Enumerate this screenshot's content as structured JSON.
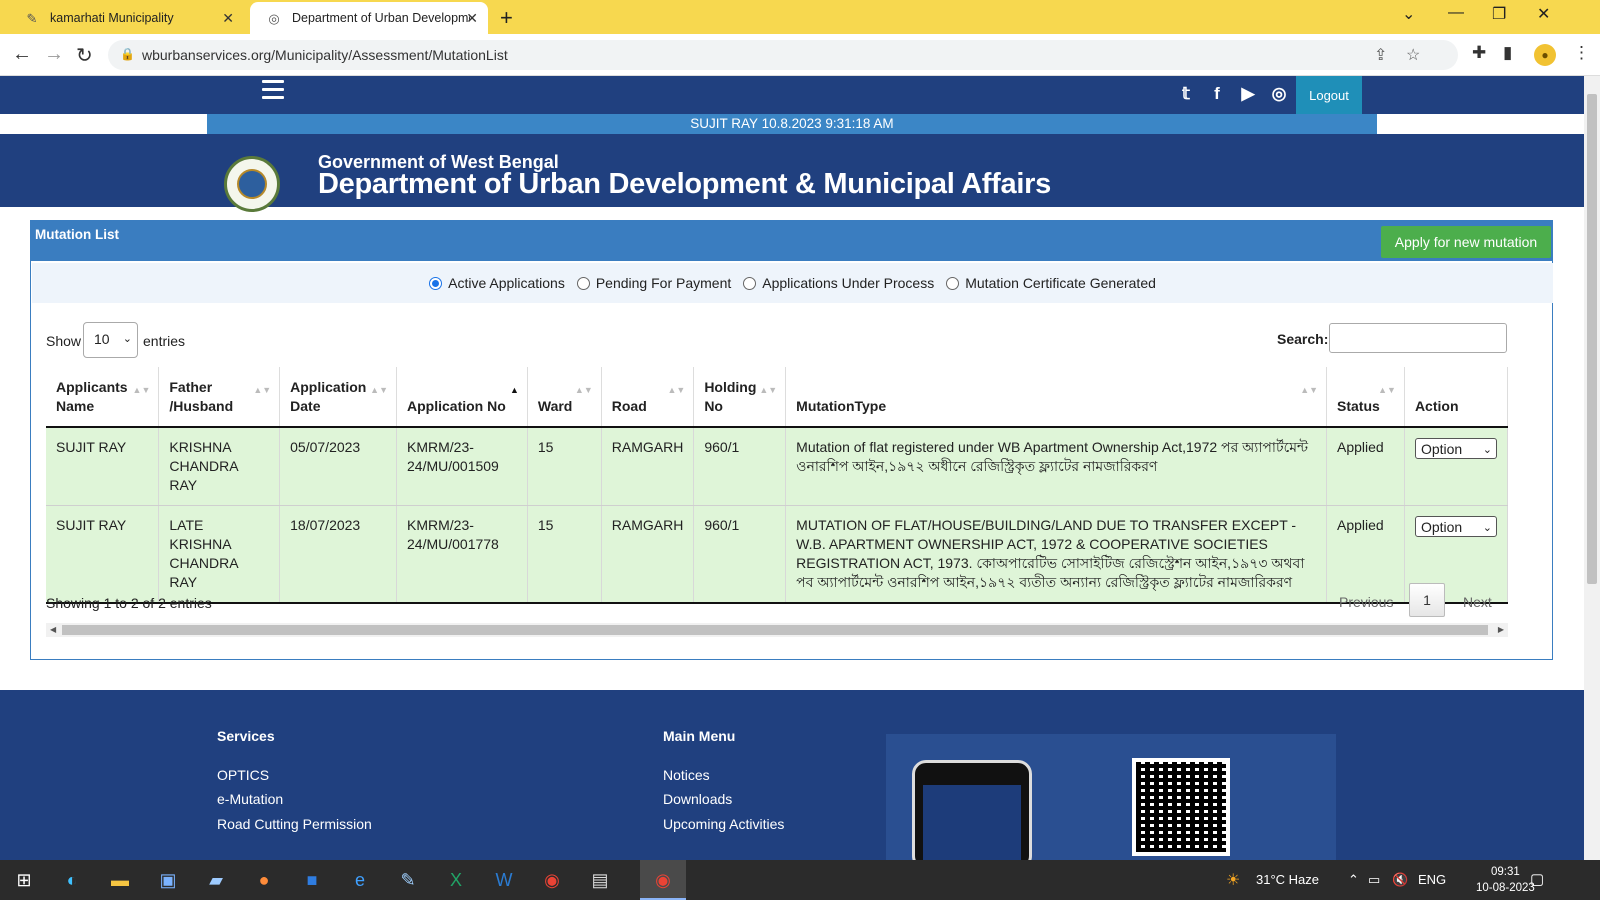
{
  "browser": {
    "tabs": [
      {
        "title": "kamarhati Municipality",
        "active": false
      },
      {
        "title": "Department of Urban Developme",
        "active": true
      }
    ],
    "url": "wburbanservices.org/Municipality/Assessment/MutationList"
  },
  "header": {
    "logout_label": "Logout",
    "user_line": "SUJIT RAY  10.8.2023 9:31:18 AM",
    "gov_line": "Government of West Bengal",
    "dept_line": "Department of Urban Development & Municipal Affairs",
    "social_icons": [
      "twitter-icon",
      "facebook-icon",
      "youtube-icon",
      "instagram-icon"
    ]
  },
  "panel": {
    "title": "Mutation List",
    "apply_button": "Apply for new mutation",
    "filters": [
      {
        "label": "Active Applications",
        "checked": true
      },
      {
        "label": "Pending For Payment",
        "checked": false
      },
      {
        "label": "Applications Under Process",
        "checked": false
      },
      {
        "label": "Mutation Certificate Generated",
        "checked": false
      }
    ],
    "show_label": "Show",
    "page_length": "10",
    "entries_label": "entries",
    "search_label": "Search:",
    "search_value": ""
  },
  "table": {
    "headers": [
      "Applicants Name",
      "Father /Husband",
      "Application Date",
      "Application No",
      "Ward",
      "Road",
      "Holding No",
      "MutationType",
      "Status",
      "Action"
    ],
    "rows": [
      {
        "name": "SUJIT RAY",
        "father": "KRISHNA CHANDRA RAY",
        "date": "05/07/2023",
        "app_no": "KMRM/23-24/MU/001509",
        "ward": "15",
        "road": "RAMGARH",
        "holding": "960/1",
        "type": "Mutation of flat registered under WB Apartment Ownership Act,1972 পর অ্যাপার্টমেন্ট ওনারশিপ আইন,১৯৭২ অধীনে রেজিস্ট্রিকৃত ফ্ল্যাটের নামজারিকরণ",
        "status": "Applied",
        "action": "Option"
      },
      {
        "name": "SUJIT RAY",
        "father": "LATE KRISHNA CHANDRA RAY",
        "date": "18/07/2023",
        "app_no": "KMRM/23-24/MU/001778",
        "ward": "15",
        "road": "RAMGARH",
        "holding": "960/1",
        "type": "MUTATION OF FLAT/HOUSE/BUILDING/LAND DUE TO TRANSFER EXCEPT - W.B. APARTMENT OWNERSHIP ACT, 1972 & COOPERATIVE SOCIETIES REGISTRATION ACT, 1973. কোঅপারেটিভ সোসাইটিজ রেজিস্ট্রেশন আইন,১৯৭৩ অথবা পব অ্যাপার্টমেন্ট ওনারশিপ আইন,১৯৭২ ব্যতীত অন্যান্য রেজিস্ট্রিকৃত ফ্ল্যাটের নামজারিকরণ",
        "status": "Applied",
        "action": "Option"
      }
    ],
    "info": "Showing 1 to 2 of 2 entries",
    "prev": "Previous",
    "page": "1",
    "next": "Next"
  },
  "footer": {
    "services_title": "Services",
    "services": [
      "OPTICS",
      "e-Mutation",
      "Road Cutting Permission"
    ],
    "menu_title": "Main Menu",
    "menu": [
      "Notices",
      "Downloads",
      "Upcoming Activities"
    ]
  },
  "taskbar": {
    "weather": "31°C  Haze",
    "lang": "ENG",
    "time": "09:31",
    "date": "10-08-2023"
  },
  "colors": {
    "nav_blue": "#20407f",
    "panel_blue": "#3a7dc0",
    "row_green": "#dff5d8",
    "apply_green": "#4cae4c",
    "tab_yellow": "#f7d84f"
  }
}
